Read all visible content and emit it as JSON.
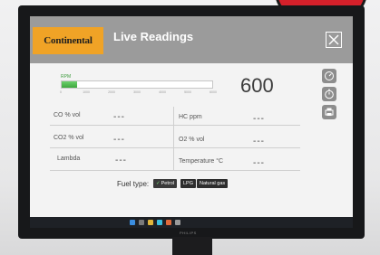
{
  "app": {
    "logo_text": "Continental",
    "title": "Live Readings"
  },
  "rpm": {
    "label": "RPM",
    "value": "600",
    "fill_fraction": 0.1,
    "ticks": [
      "0",
      "1000",
      "2000",
      "3000",
      "4000",
      "5000",
      "6000"
    ]
  },
  "readings": [
    {
      "label": "CO % vol",
      "value": "---"
    },
    {
      "label": "HC ppm",
      "value": "---"
    },
    {
      "label": "CO2 % vol",
      "value": "---"
    },
    {
      "label": "O2 % vol",
      "value": "---"
    },
    {
      "label": "Lambda",
      "value": "---"
    },
    {
      "label": "Temperature °C",
      "value": "---"
    }
  ],
  "fuel": {
    "label": "Fuel type:",
    "options": [
      "Petrol",
      "LPG",
      "Natural gas"
    ],
    "selected": "Petrol"
  },
  "icons": {
    "close": "close-icon",
    "side": [
      "gauge-icon",
      "timer-icon",
      "printer-icon"
    ]
  },
  "monitor_brand": "PHILIPS",
  "colors": {
    "header": "#9b9b9b",
    "logo_bg": "#f0a326",
    "rpm_fill": "#4cb84c",
    "sticker": "#d4202a"
  }
}
